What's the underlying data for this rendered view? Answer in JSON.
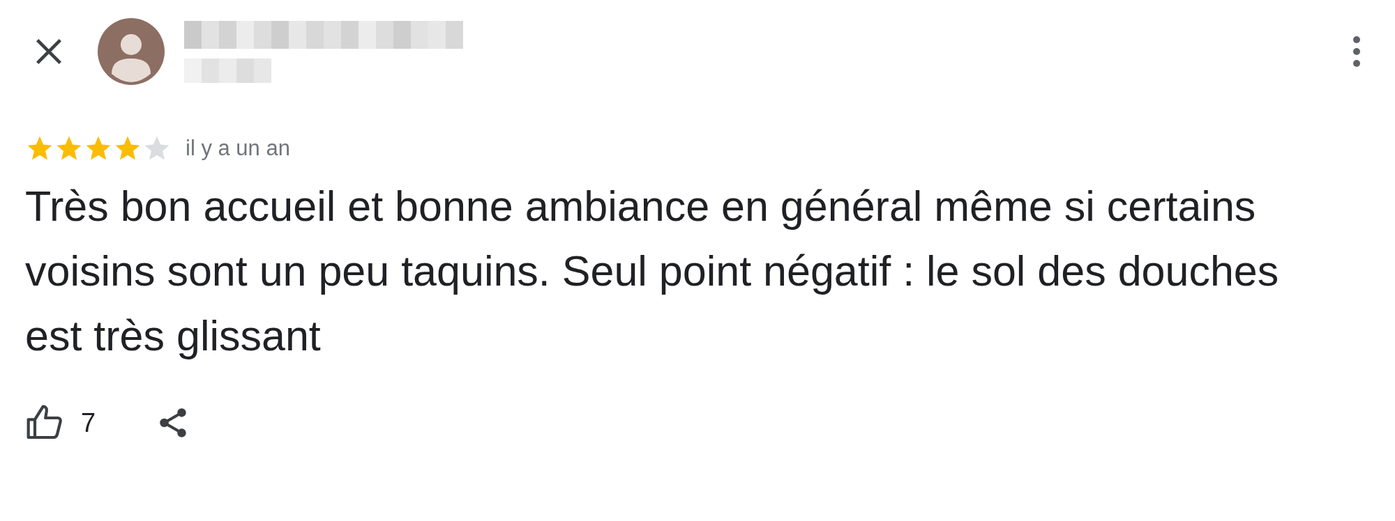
{
  "review": {
    "stars": 4,
    "time": "il y a un an",
    "text": "Très bon accueil et bonne ambiance en général même si certains voisins sont un peu taquins. Seul point négatif : le sol des douches est très glissant"
  },
  "actions": {
    "likes": "7"
  }
}
